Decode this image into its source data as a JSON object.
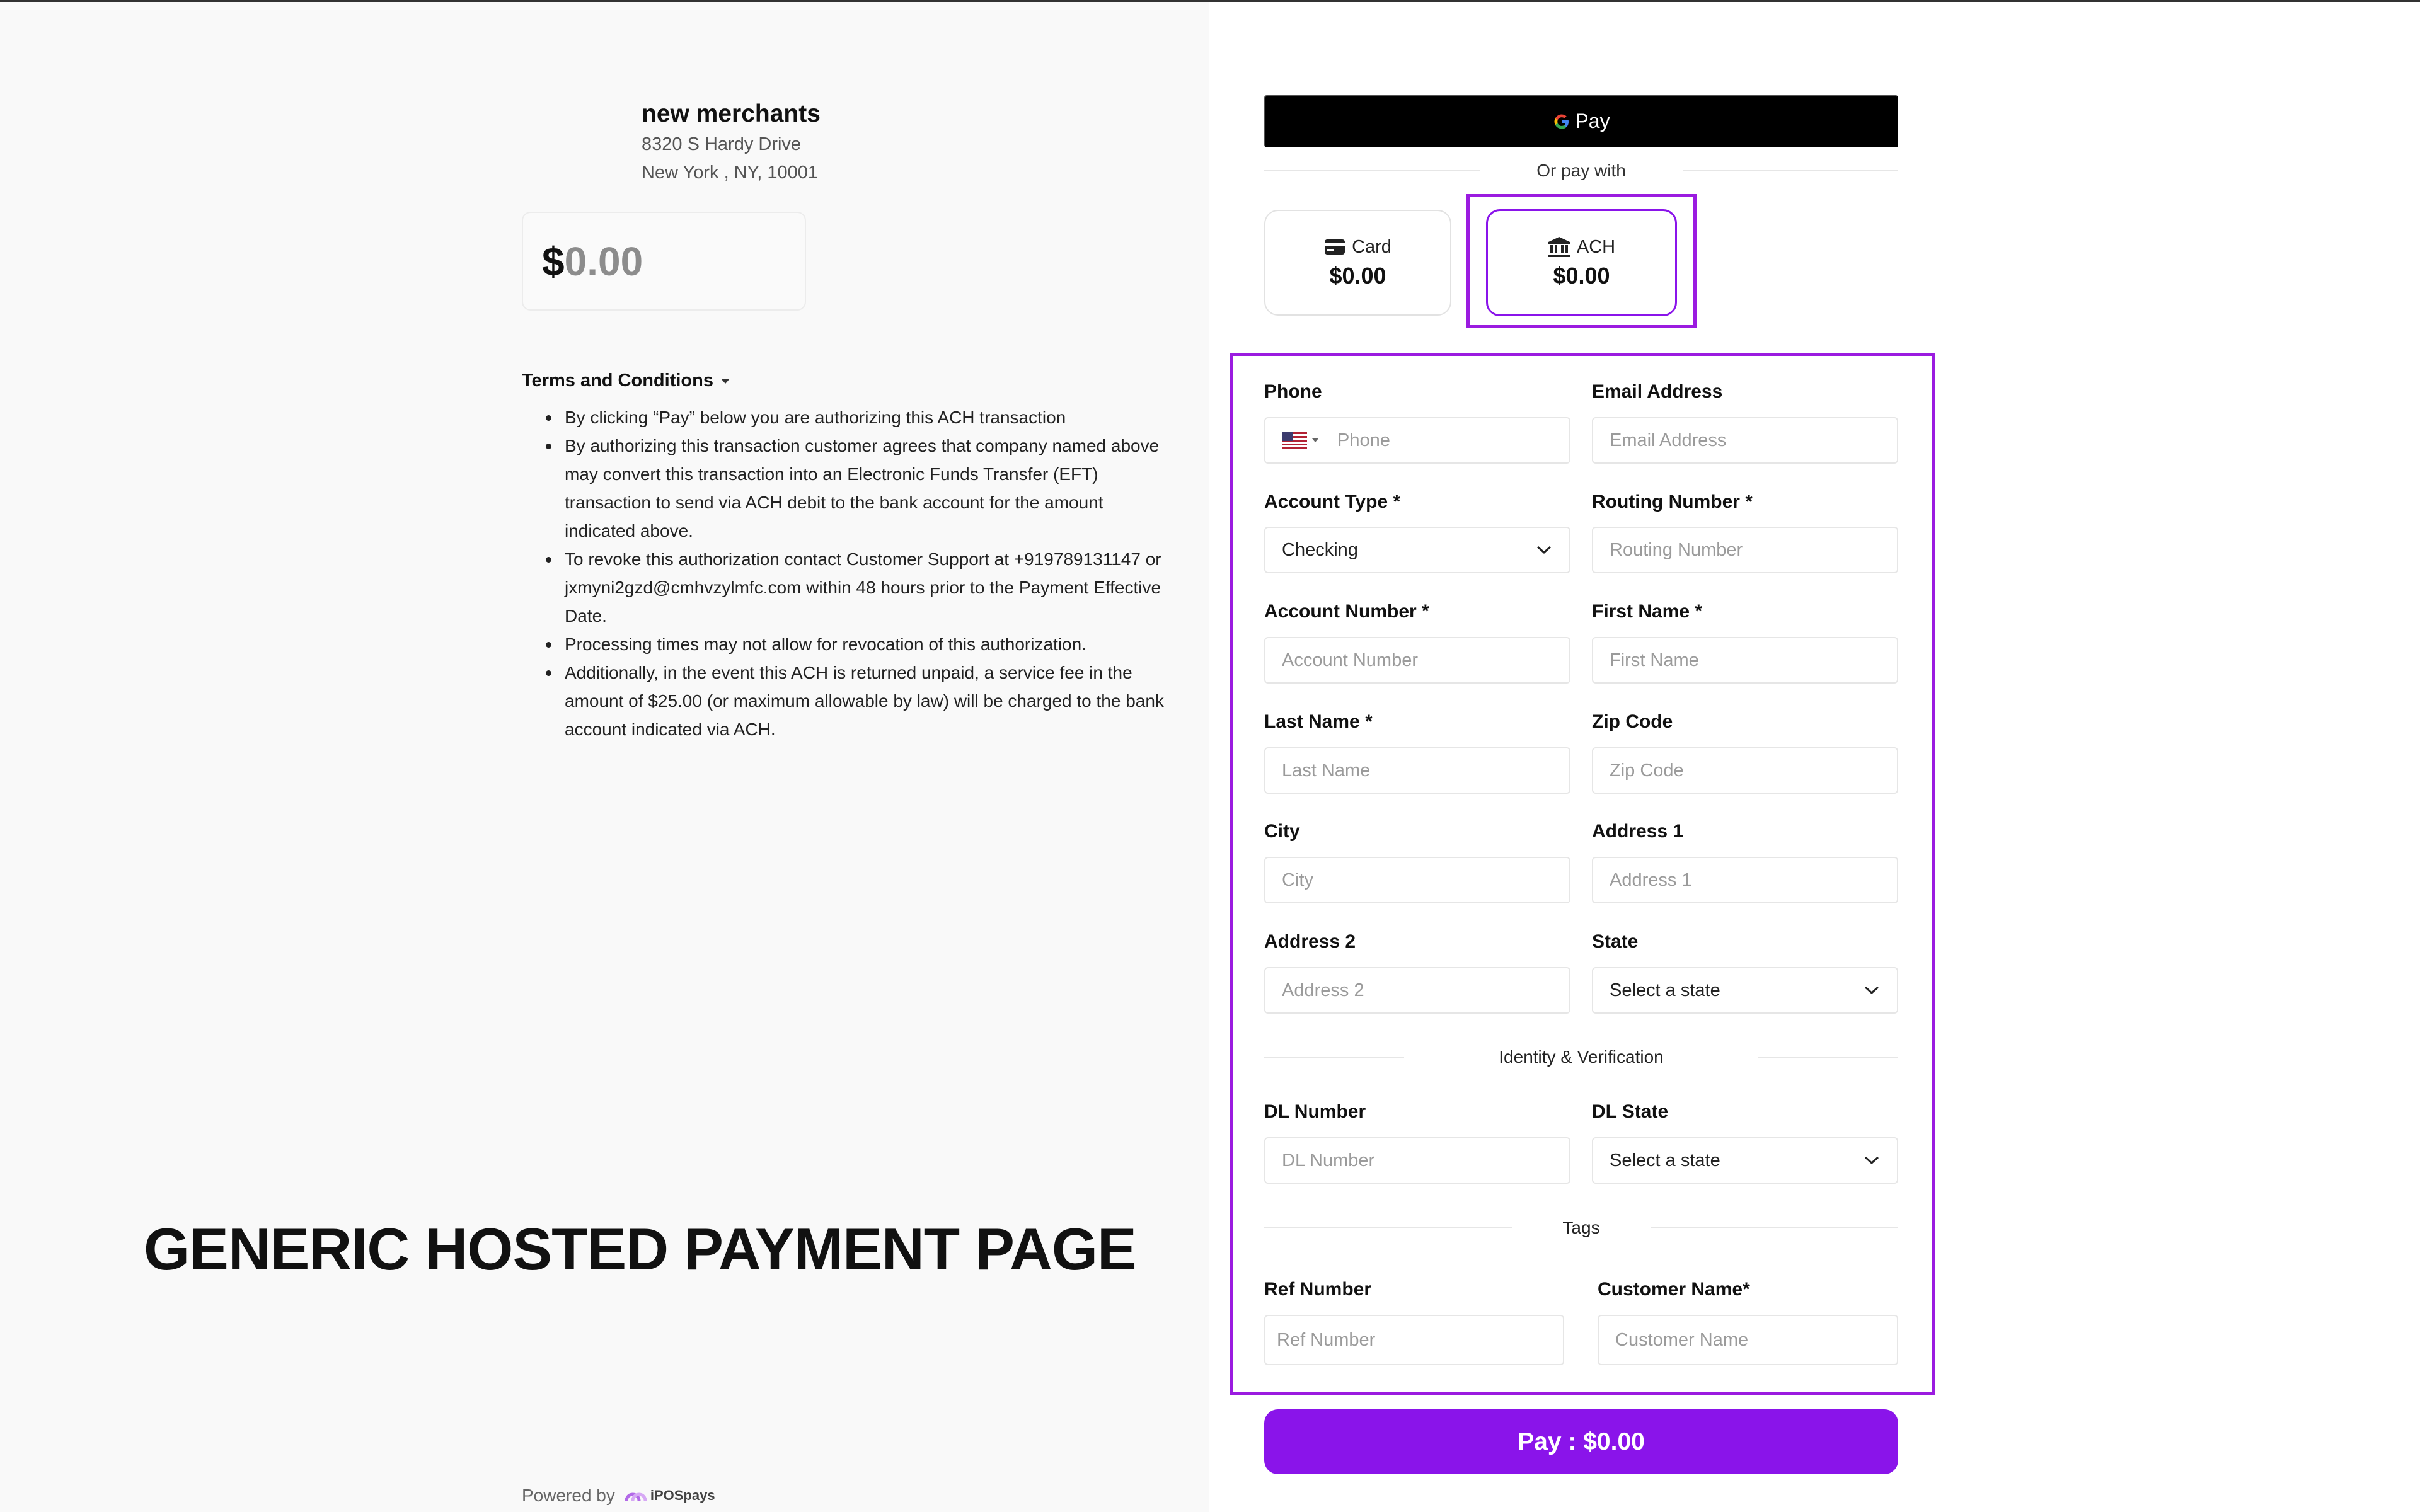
{
  "merchant": {
    "name": "new merchants",
    "address_line1": "8320 S Hardy Drive",
    "address_line2": "New York , NY, 10001"
  },
  "amount": {
    "currency_symbol": "$",
    "value": "0.00"
  },
  "terms": {
    "title": "Terms and Conditions",
    "items": [
      "By clicking “Pay” below you are authorizing this ACH transaction",
      "By authorizing this transaction customer agrees that company named above may convert this transaction into an Electronic Funds Transfer (EFT) transaction to send via ACH debit to the bank account for the amount indicated above.",
      "To revoke this authorization contact Customer Support at +919789131147 or jxmyni2gzd@cmhvzylmfc.com within 48 hours prior to the Payment Effective Date.",
      "Processing times may not allow for revocation of this authorization.",
      "Additionally, in the event this ACH is returned unpaid, a service fee in the amount of $25.00 (or maximum allowable by law) will be charged to the bank account indicated via ACH."
    ]
  },
  "banner": "GENERIC HOSTED PAYMENT PAGE",
  "footer": {
    "powered_by": "Powered by",
    "logo_text": "iPOSpays"
  },
  "gpay": {
    "label": "Pay",
    "icon": "google-g-icon"
  },
  "or_pay_with": "Or pay with",
  "methods": {
    "card": {
      "label": "Card",
      "amount": "$0.00",
      "icon": "credit-card-icon"
    },
    "ach": {
      "label": "ACH",
      "amount": "$0.00",
      "icon": "bank-icon",
      "selected": true
    }
  },
  "form": {
    "phone": {
      "label": "Phone",
      "placeholder": "Phone",
      "flag": "us-flag-icon"
    },
    "email": {
      "label": "Email Address",
      "placeholder": "Email Address"
    },
    "account_type": {
      "label": "Account Type *",
      "value": "Checking"
    },
    "routing_number": {
      "label": "Routing Number *",
      "placeholder": "Routing Number"
    },
    "account_number": {
      "label": "Account Number *",
      "placeholder": "Account Number"
    },
    "first_name": {
      "label": "First Name *",
      "placeholder": "First Name"
    },
    "last_name": {
      "label": "Last Name *",
      "placeholder": "Last Name"
    },
    "zip_code": {
      "label": "Zip Code",
      "placeholder": "Zip Code"
    },
    "city": {
      "label": "City",
      "placeholder": "City"
    },
    "address1": {
      "label": "Address 1",
      "placeholder": "Address 1"
    },
    "address2": {
      "label": "Address 2",
      "placeholder": "Address 2"
    },
    "state": {
      "label": "State",
      "value": "Select a state"
    },
    "identity_section": "Identity & Verification",
    "dl_number": {
      "label": "DL Number",
      "placeholder": "DL Number"
    },
    "dl_state": {
      "label": "DL State",
      "value": "Select a state"
    },
    "tags_section": "Tags",
    "ref_number": {
      "label": "Ref Number",
      "placeholder": "Ref Number"
    },
    "customer_name": {
      "label": "Customer Name*",
      "placeholder": "Customer Name"
    }
  },
  "pay_button": "Pay : $0.00",
  "colors": {
    "accent": "#8a14ea",
    "highlight_frame": "#9b1be0",
    "gpay_bg": "#000000"
  }
}
